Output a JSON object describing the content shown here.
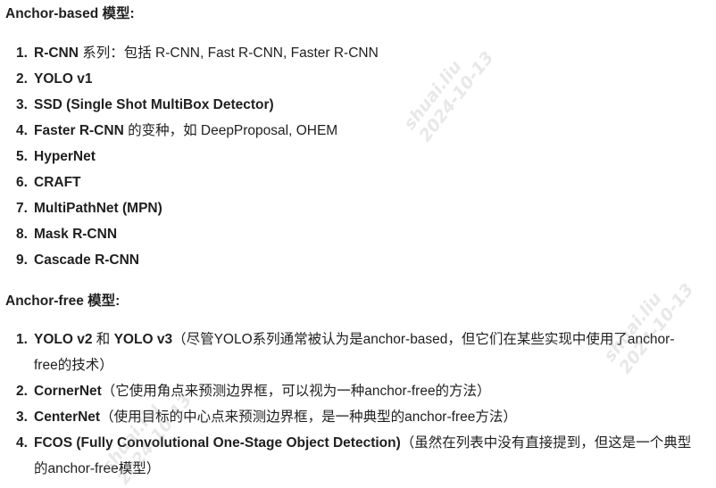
{
  "sections": [
    {
      "heading_en": "Anchor-based",
      "heading_zh": " 模型:",
      "items": [
        {
          "num": "1.",
          "bold": "R-CNN",
          "rest": " 系列：包括 R-CNN, Fast R-CNN, Faster R-CNN"
        },
        {
          "num": "2.",
          "bold": "YOLO v1",
          "rest": ""
        },
        {
          "num": "3.",
          "bold": "SSD (Single Shot MultiBox Detector)",
          "rest": ""
        },
        {
          "num": "4.",
          "bold": "Faster R-CNN",
          "rest": " 的变种，如 DeepProposal, OHEM"
        },
        {
          "num": "5.",
          "bold": "HyperNet",
          "rest": ""
        },
        {
          "num": "6.",
          "bold": "CRAFT",
          "rest": ""
        },
        {
          "num": "7.",
          "bold": "MultiPathNet (MPN)",
          "rest": ""
        },
        {
          "num": "8.",
          "bold": "Mask R-CNN",
          "rest": ""
        },
        {
          "num": "9.",
          "bold": "Cascade R-CNN",
          "rest": ""
        }
      ]
    },
    {
      "heading_en": "Anchor-free",
      "heading_zh": " 模型:",
      "items": [
        {
          "num": "1.",
          "bold": "YOLO v2",
          "mid": " 和 ",
          "bold2": "YOLO v3",
          "rest": "（尽管YOLO系列通常被认为是anchor-based，但它们在某些实现中使用了anchor-free的技术）"
        },
        {
          "num": "2.",
          "bold": "CornerNet",
          "rest": "（它使用角点来预测边界框，可以视为一种anchor-free的方法）"
        },
        {
          "num": "3.",
          "bold": "CenterNet",
          "rest": "（使用目标的中心点来预测边界框，是一种典型的anchor-free方法）"
        },
        {
          "num": "4.",
          "bold": "FCOS (Fully Convolutional One-Stage Object Detection)",
          "rest": "（虽然在列表中没有直接提到，但这是一个典型的anchor-free模型）"
        }
      ]
    }
  ],
  "watermark": {
    "line1": "shuai.liu",
    "line2": "2024-10-13"
  }
}
